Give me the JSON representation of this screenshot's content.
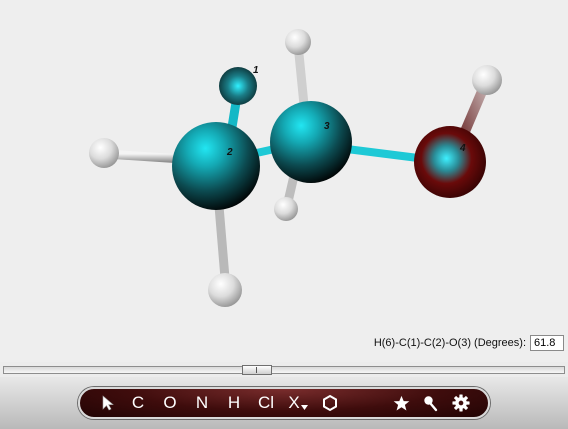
{
  "molecule": {
    "atoms": [
      {
        "label": "1"
      },
      {
        "label": "2"
      },
      {
        "label": "3"
      },
      {
        "label": "4"
      }
    ]
  },
  "measurement": {
    "label": "H(6)-C(1)-C(2)-O(3) (Degrees):",
    "value": "61.8"
  },
  "slider": {
    "value_fraction": 0.45
  },
  "toolbar": {
    "tools": [
      {
        "name": "pointer",
        "icon": "pointer-icon"
      },
      {
        "name": "carbon",
        "label": "C"
      },
      {
        "name": "oxygen",
        "label": "O"
      },
      {
        "name": "nitrogen",
        "label": "N"
      },
      {
        "name": "hydrogen",
        "label": "H"
      },
      {
        "name": "chlorine",
        "label": "Cl"
      },
      {
        "name": "other-element",
        "label": "X"
      },
      {
        "name": "ring",
        "icon": "hexagon-icon"
      },
      {
        "name": "favorite",
        "icon": "star-icon"
      },
      {
        "name": "measure",
        "icon": "pin-icon"
      },
      {
        "name": "settings",
        "icon": "gear-icon"
      }
    ]
  },
  "colors": {
    "carbon": "#1ec9d6",
    "oxygen": "#8a0c0c",
    "hydrogen": "#e6e6e6",
    "toolbar_bg": "#3e0c0c"
  }
}
